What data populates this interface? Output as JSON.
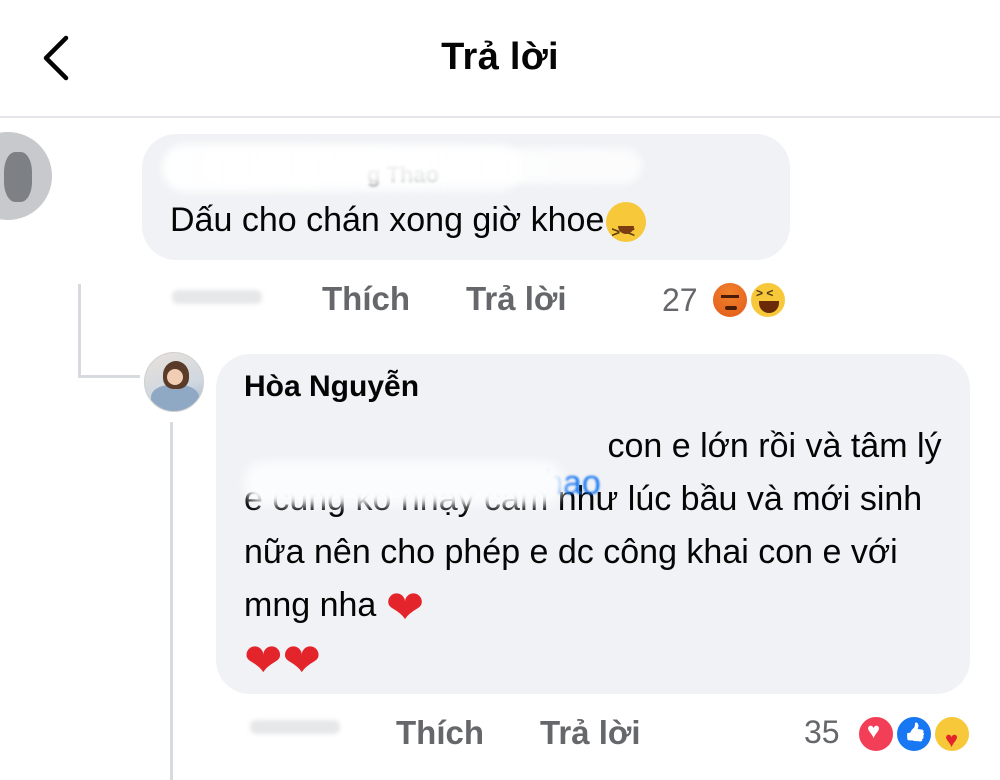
{
  "header": {
    "title": "Trả lời"
  },
  "comment_1": {
    "author_fragment": "g Thao",
    "text": "Dấu cho chán xong giờ khoe",
    "actions": {
      "like": "Thích",
      "reply": "Trả lời"
    },
    "reaction_count": "27",
    "reactions": [
      "angry",
      "haha"
    ]
  },
  "comment_2": {
    "author": "Hòa Nguyễn",
    "mention_fragment": "hao",
    "text": "con e lớn rồi và tâm lý e cũng ko nhạy cảm như lúc bầu và mới sinh nữa nên cho phép e dc công khai con e với mng nha",
    "actions": {
      "like": "Thích",
      "reply": "Trả lời"
    },
    "reaction_count": "35",
    "reactions": [
      "love",
      "like",
      "care"
    ]
  },
  "icons": {
    "back": "chevron-left-icon",
    "heart": "red-heart-emoji"
  },
  "colors": {
    "bubble": "#f0f2f5",
    "secondary_text": "#65676b",
    "link_blue": "#1877f2",
    "heart_red": "#e3242b"
  }
}
